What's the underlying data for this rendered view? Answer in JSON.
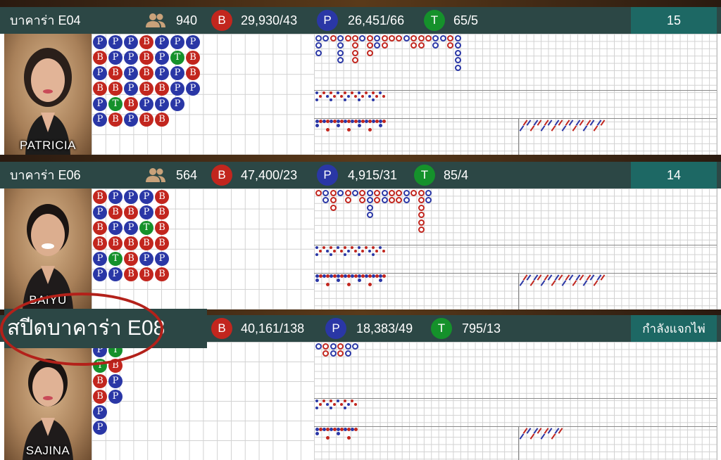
{
  "colors": {
    "header_bg": "#2c4745",
    "banker": "#c2261e",
    "player": "#2a37a6",
    "tie": "#15912b"
  },
  "tables": [
    {
      "name": "บาคาร่า E04",
      "players_count": "940",
      "banker_label": "B",
      "banker_stat": "29,930/43",
      "player_label": "P",
      "player_stat": "26,451/66",
      "tie_label": "T",
      "tie_stat": "65/5",
      "timer": "15",
      "dealer": "PATRICIA",
      "bead_road": [
        [
          "P",
          "B",
          "P",
          "B",
          "P",
          "P"
        ],
        [
          "P",
          "P",
          "B",
          "B",
          "T",
          "B"
        ],
        [
          "P",
          "P",
          "P",
          "P",
          "B",
          "P"
        ],
        [
          "B",
          "B",
          "B",
          "B",
          "P",
          "B"
        ],
        [
          "P",
          "P",
          "P",
          "B",
          "P",
          "B"
        ],
        [
          "P",
          "T",
          "P",
          "P",
          "P"
        ],
        [
          "P",
          "B",
          "B",
          "P"
        ]
      ]
    },
    {
      "name": "บาคาร่า E06",
      "players_count": "564",
      "banker_label": "B",
      "banker_stat": "47,400/23",
      "player_label": "P",
      "player_stat": "4,915/31",
      "tie_label": "T",
      "tie_stat": "85/4",
      "timer": "14",
      "dealer": "BAIYU",
      "bead_road": [
        [
          "B",
          "P",
          "B",
          "B",
          "P",
          "P"
        ],
        [
          "P",
          "B",
          "P",
          "B",
          "T",
          "P"
        ],
        [
          "P",
          "B",
          "P",
          "B",
          "B",
          "B"
        ],
        [
          "P",
          "P",
          "T",
          "B",
          "P",
          "B"
        ],
        [
          "B",
          "B",
          "B",
          "B",
          "P",
          "B"
        ]
      ]
    },
    {
      "name": "สปีดบาคาร่า E08",
      "banker_label": "B",
      "banker_stat": "40,161/138",
      "player_label": "P",
      "player_stat": "18,383/49",
      "tie_label": "T",
      "tie_stat": "795/13",
      "status": "กำลังแจกไพ่",
      "dealer": "SAJINA",
      "bead_road": [
        [
          "P",
          "T",
          "B",
          "B",
          "P",
          "P"
        ],
        [
          "T",
          "B",
          "P",
          "P"
        ]
      ]
    }
  ]
}
